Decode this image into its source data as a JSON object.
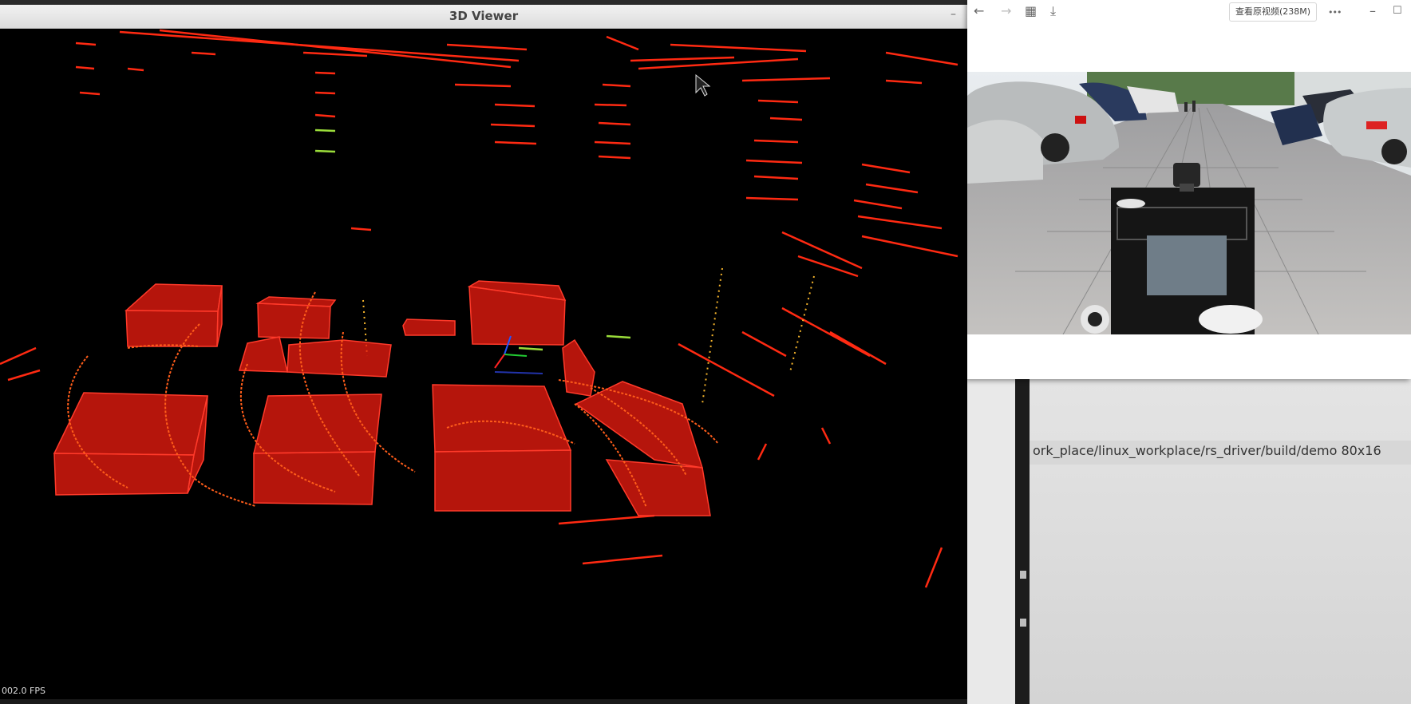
{
  "viewer": {
    "title": "3D Viewer",
    "fps": "002.0 FPS",
    "minimize_glyph": "–"
  },
  "player": {
    "view_original_label": "查看原视频(238M)",
    "icons": {
      "back": "←",
      "forward": "→",
      "grid": "▦",
      "download": "⤓",
      "more": "•••",
      "minimize": "–",
      "maximize": "☐"
    }
  },
  "terminal": {
    "command_line": "ork_place/linux_workplace/rs_driver/build/demo 80x16"
  },
  "colors": {
    "points": "#ff2a12",
    "boxes": "#e81b10",
    "highlight_green": "#9adc3a",
    "highlight_yellow": "#f6b52c"
  }
}
